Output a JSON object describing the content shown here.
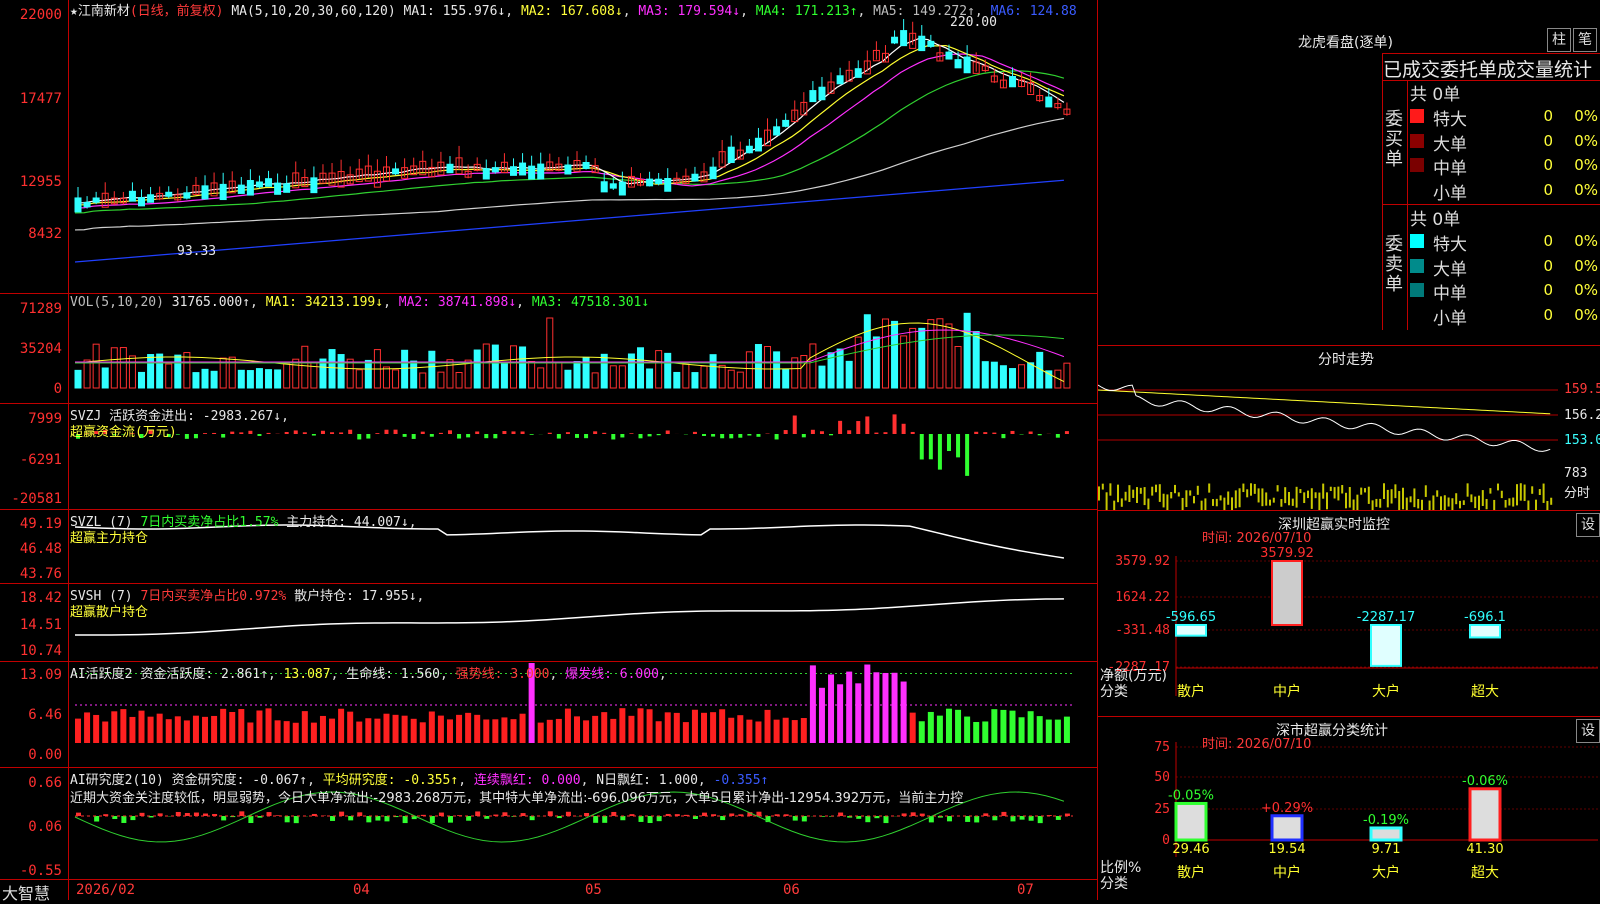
{
  "main": {
    "star": "★",
    "stock_name": "江南新材",
    "period": "(日线，前复权)",
    "ma_label": "MA(5,10,20,30,60,120)",
    "ma1": "MA1: 155.976↓",
    "ma2": "MA2: 167.608↓",
    "ma3": "MA3: 179.594↓",
    "ma4": "MA4: 171.213↑",
    "ma5": "MA5: 149.272↑",
    "ma6": "MA6: 124.88",
    "y_ticks": [
      "22000",
      "17477",
      "12955",
      "8432"
    ],
    "high_mark": "220.00",
    "low_mark": "93.33"
  },
  "volume": {
    "label": "VOL(5,10,20)",
    "value": "31765.000↑",
    "ma1": "MA1: 34213.199↓",
    "ma2": "MA2: 38741.898↓",
    "ma3": "MA3: 47518.301↓",
    "y_ticks": [
      "71289",
      "35204",
      "0"
    ]
  },
  "svzj": {
    "label": "SVZJ",
    "desc": "活跃资金进出: -2983.267↓",
    "sub": "超赢资金流(万元)",
    "y_ticks": [
      "7999",
      "-6291",
      "-20581"
    ]
  },
  "svzl": {
    "label": "SVZL (7)",
    "desc1": "7日内买卖净占比1.57%",
    "desc2": "主力持仓: 44.007↓",
    "sub": "超赢主力持仓",
    "y_ticks": [
      "49.19",
      "46.48",
      "43.76"
    ]
  },
  "svsh": {
    "label": "SVSH (7)",
    "desc1": "7日内买卖净占比0.972%",
    "desc2": "散户持仓: 17.955↓",
    "sub": "超赢散户持仓",
    "y_ticks": [
      "18.42",
      "14.51",
      "10.74"
    ]
  },
  "ai_act": {
    "label": "AI活跃度2",
    "v1": "资金活跃度: 2.861↑",
    "v2": "13.087",
    "v3": "生命线: 1.560",
    "v4": "强势线: 3.000",
    "v5": "爆发线: 6.000",
    "y_ticks": [
      "13.09",
      "6.46",
      "0.00"
    ]
  },
  "ai_res": {
    "label": "AI研究度2(10)",
    "v1": "资金研究度: -0.067↑",
    "v2": "平均研究度: -0.355↑",
    "v3": "连续飘红: 0.000",
    "v4": "N日飘红: 1.000",
    "v5": "-0.355↑",
    "comment": "近期大资金关注度较低，明显弱势，今日大单净流出:-2983.268万元，其中特大单净流出:-696.096万元，大单5日累计净出-12954.392万元，当前主力控",
    "y_ticks": [
      "0.66",
      "0.06",
      "-0.55"
    ]
  },
  "xaxis": {
    "brand": "大智慧",
    "labels": [
      "2026/02",
      "04",
      "05",
      "06",
      "07"
    ]
  },
  "lhb": {
    "title": "龙虎看盘(逐单)",
    "btn1": "柱",
    "btn2": "笔",
    "header": "已成交委托单成交量统计",
    "buy_side": "委买单",
    "sell_side": "委卖单",
    "buy_total": "共 0单",
    "sell_total": "共 0单",
    "buy_rows": [
      {
        "label": "特大",
        "count": "0",
        "pct": "0%",
        "color": "#ff1a1a"
      },
      {
        "label": "大单",
        "count": "0",
        "pct": "0%",
        "color": "#8b0000"
      },
      {
        "label": "中单",
        "count": "0",
        "pct": "0%",
        "color": "#7a0000"
      },
      {
        "label": "小单",
        "count": "0",
        "pct": "0%",
        "color": "#000000"
      }
    ],
    "sell_rows": [
      {
        "label": "特大",
        "count": "0",
        "pct": "0%",
        "color": "#00ffff"
      },
      {
        "label": "大单",
        "count": "0",
        "pct": "0%",
        "color": "#008b8b"
      },
      {
        "label": "中单",
        "count": "0",
        "pct": "0%",
        "color": "#007a7a"
      },
      {
        "label": "小单",
        "count": "0",
        "pct": "0%",
        "color": "#000000"
      }
    ]
  },
  "intraday": {
    "title": "分时走势",
    "p1": "159.5",
    "p2": "156.2",
    "p3": "153.0",
    "vol": "783",
    "unit": "分时"
  },
  "monitor": {
    "title": "深圳超赢实时监控",
    "btn": "设",
    "time": "时间: 2026/07/10",
    "y_ticks": [
      "3579.92",
      "1624.22",
      "-331.48",
      "-2287.17"
    ],
    "values": [
      "-596.65",
      "3579.92",
      "-2287.17",
      "-696.1"
    ],
    "ylabel": "净额(万元)",
    "xlabel": "分类",
    "cats": [
      "散户",
      "中户",
      "大户",
      "超大"
    ]
  },
  "classify": {
    "title": "深市超赢分类统计",
    "btn": "设",
    "time": "时间: 2026/07/10",
    "y_ticks": [
      "75",
      "50",
      "25",
      "0"
    ],
    "pct_changes": [
      "-0.05%",
      "+0.29%",
      "-0.19%",
      "-0.06%"
    ],
    "values": [
      "29.46",
      "19.54",
      "9.71",
      "41.30"
    ],
    "ylabel": "比例%",
    "xlabel": "分类",
    "cats": [
      "散户",
      "中户",
      "大户",
      "超大"
    ]
  }
}
